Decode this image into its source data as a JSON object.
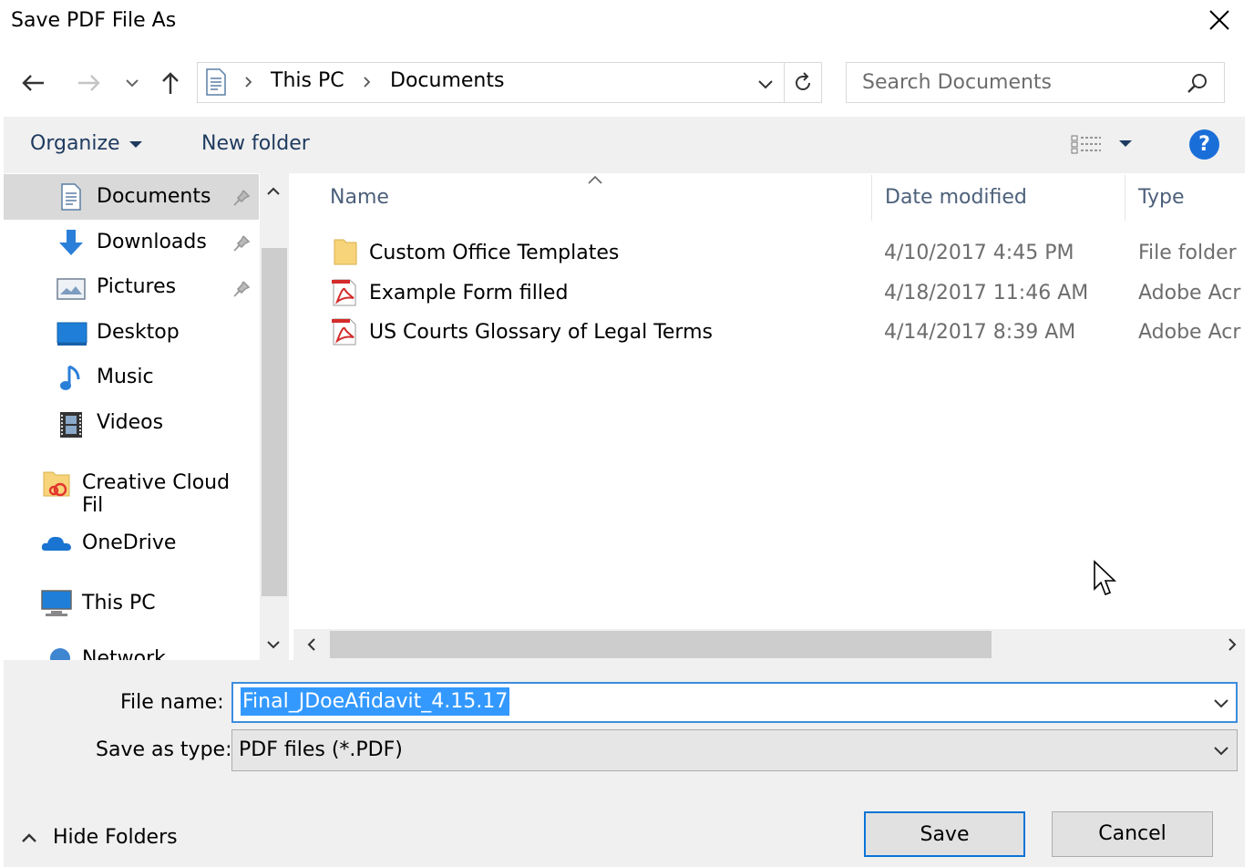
{
  "window": {
    "title": "Save PDF File As"
  },
  "address": {
    "crumbs": [
      "This PC",
      "Documents"
    ]
  },
  "search": {
    "placeholder": "Search Documents"
  },
  "toolbar": {
    "organize": "Organize",
    "new_folder": "New folder",
    "help": "?"
  },
  "nav": {
    "items": [
      {
        "label": "Documents",
        "icon": "documents-icon"
      },
      {
        "label": "Downloads",
        "icon": "downloads-icon"
      },
      {
        "label": "Pictures",
        "icon": "pictures-icon"
      },
      {
        "label": "Desktop",
        "icon": "desktop-icon"
      },
      {
        "label": "Music",
        "icon": "music-icon"
      },
      {
        "label": "Videos",
        "icon": "videos-icon"
      },
      {
        "label": "Creative Cloud Fil",
        "icon": "creative-cloud-icon"
      },
      {
        "label": "OneDrive",
        "icon": "onedrive-icon"
      },
      {
        "label": "This PC",
        "icon": "this-pc-icon"
      },
      {
        "label": "Network",
        "icon": "network-icon"
      }
    ]
  },
  "files": {
    "columns": {
      "name": "Name",
      "date": "Date modified",
      "type": "Type"
    },
    "rows": [
      {
        "name": "Custom Office Templates",
        "date": "4/10/2017 4:45 PM",
        "type": "File folder",
        "icon": "folder-icon"
      },
      {
        "name": "Example Form filled",
        "date": "4/18/2017 11:46 AM",
        "type": "Adobe Acr",
        "icon": "pdf-icon"
      },
      {
        "name": "US Courts Glossary of Legal Terms",
        "date": "4/14/2017 8:39 AM",
        "type": "Adobe Acr",
        "icon": "pdf-icon"
      }
    ]
  },
  "form": {
    "file_name_label": "File name:",
    "file_name_value": "Final_JDoeAfidavit_4.15.17",
    "save_type_label": "Save as type:",
    "save_type_value": "PDF files (*.PDF)"
  },
  "buttons": {
    "save": "Save",
    "cancel": "Cancel",
    "hide_folders": "Hide Folders"
  },
  "colors": {
    "accent": "#0a74d7",
    "selection": "#3399ff",
    "help": "#1a6ed8"
  }
}
